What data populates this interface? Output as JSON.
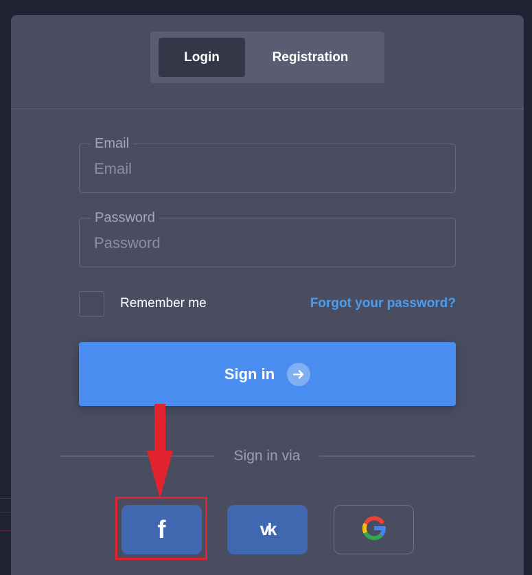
{
  "tabs": {
    "login_label": "Login",
    "registration_label": "Registration",
    "active": "Login"
  },
  "email": {
    "label": "Email",
    "placeholder": "Email",
    "value": ""
  },
  "password": {
    "label": "Password",
    "placeholder": "Password",
    "value": ""
  },
  "remember": {
    "label": "Remember me",
    "checked": false
  },
  "forgot_label": "Forgot your password?",
  "signin": {
    "label": "Sign in",
    "icon": "arrow-right-icon"
  },
  "sign_in_via_label": "Sign in via",
  "social": [
    {
      "name": "facebook",
      "icon": "facebook-icon",
      "glyph": "f"
    },
    {
      "name": "vk",
      "icon": "vk-icon",
      "glyph": "vk"
    },
    {
      "name": "google",
      "icon": "google-icon",
      "glyph": "G"
    }
  ],
  "colors": {
    "card": "#4a4d60",
    "accent": "#4a8df0",
    "link": "#4a9ef0",
    "social": "#3f68b1",
    "annotation": "#e2222d"
  }
}
